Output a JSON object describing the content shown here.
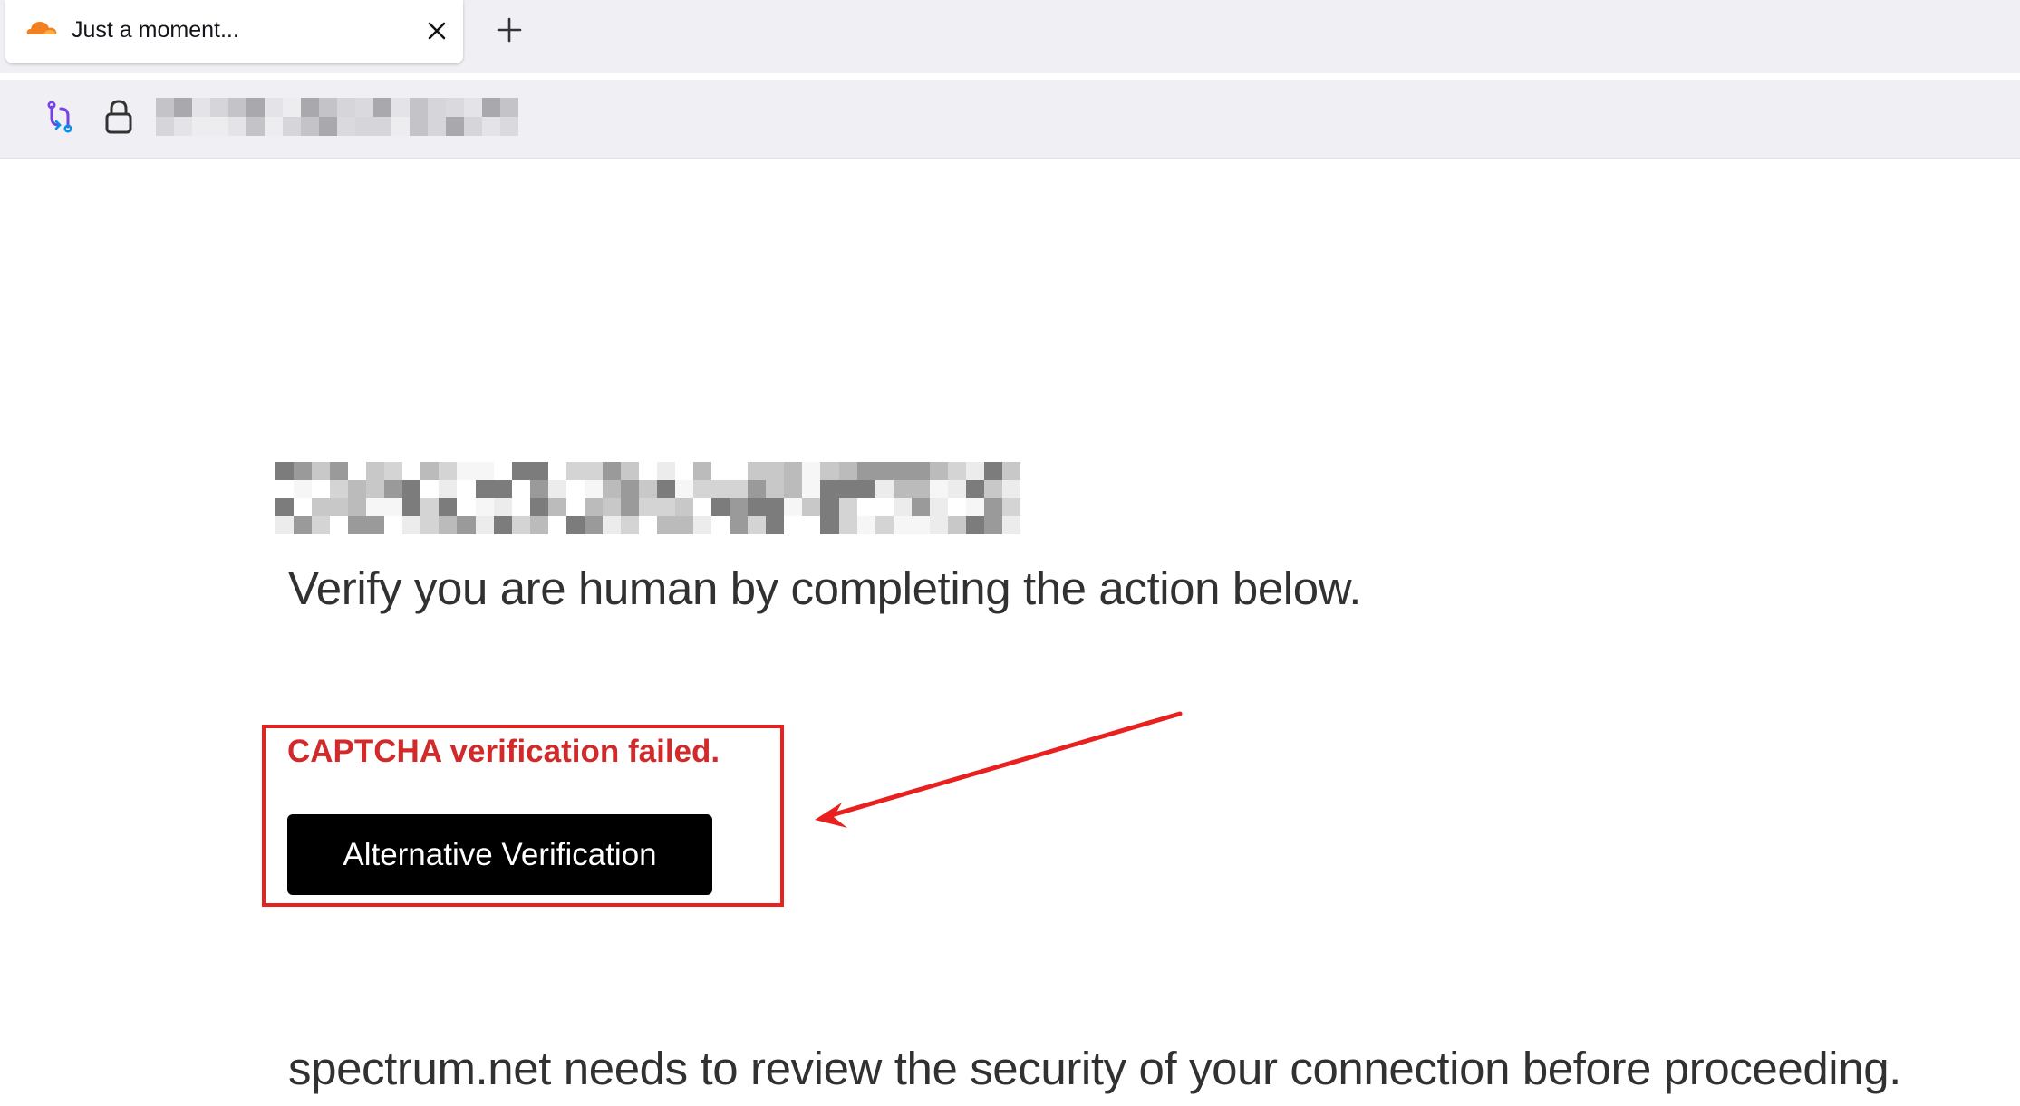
{
  "browser": {
    "tab": {
      "title": "Just a moment...",
      "favicon": "cloudflare-cloud-icon",
      "close_icon": "close-icon"
    },
    "new_tab_icon": "plus-icon",
    "navbar": {
      "tracking_icon": "tracking-protection-icon",
      "lock_icon": "lock-icon",
      "url": ""
    }
  },
  "page": {
    "site_name": "",
    "heading": "Verify you are human by completing the action below.",
    "error": "CAPTCHA verification failed.",
    "button_label": "Alternative Verification",
    "footer": "spectrum.net needs to review the security of your connection before proceeding."
  },
  "annotation": {
    "color": "#e8211f",
    "highlight": "red-box-around-error-and-button",
    "arrow": "red-arrow-pointing-left"
  },
  "colors": {
    "error_text": "#d22a2a",
    "button_bg": "#000000",
    "button_text": "#ffffff",
    "body_text": "#313131",
    "chrome_bg": "#f0f0f4"
  }
}
